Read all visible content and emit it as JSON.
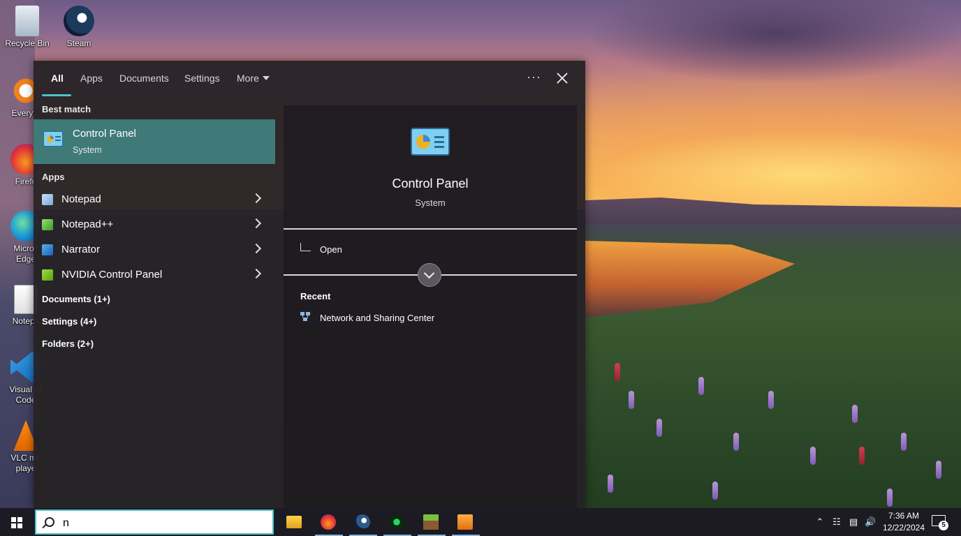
{
  "desktop": {
    "icons": [
      {
        "label": "Recycle Bin",
        "icon": "recycle-bin-icon"
      },
      {
        "label": "Steam",
        "icon": "steam-icon"
      },
      {
        "label": "Everyth",
        "icon": "everything-search-icon"
      },
      {
        "label": "Firefo",
        "icon": "firefox-icon"
      },
      {
        "label": "Micros\nEdge",
        "icon": "edge-icon"
      },
      {
        "label": "Notepa",
        "icon": "notepad-plus-plus-icon"
      },
      {
        "label": "Visual St\nCode",
        "icon": "vscode-icon"
      },
      {
        "label": "VLC me\nplaye",
        "icon": "vlc-icon"
      }
    ]
  },
  "search_panel": {
    "tabs": [
      {
        "label": "All",
        "active": true
      },
      {
        "label": "Apps"
      },
      {
        "label": "Documents"
      },
      {
        "label": "Settings"
      },
      {
        "label": "More"
      }
    ],
    "more_options_label": "···",
    "best_match": {
      "header": "Best match",
      "title": "Control Panel",
      "subtitle": "System"
    },
    "apps_header": "Apps",
    "apps": [
      {
        "label": "Notepad",
        "icon": "notepad-icon"
      },
      {
        "label": "Notepad++",
        "icon": "notepad-plus-plus-icon"
      },
      {
        "label": "Narrator",
        "icon": "narrator-icon"
      },
      {
        "label": "NVIDIA Control Panel",
        "icon": "nvidia-icon"
      }
    ],
    "groups": [
      {
        "label": "Documents (1+)"
      },
      {
        "label": "Settings (4+)"
      },
      {
        "label": "Folders (2+)"
      }
    ],
    "preview": {
      "title": "Control Panel",
      "subtitle": "System",
      "open_label": "Open",
      "recent_header": "Recent",
      "recent_items": [
        {
          "label": "Network and Sharing Center"
        }
      ]
    }
  },
  "taskbar": {
    "search_value": "n",
    "apps": [
      "file-explorer-icon",
      "firefox-icon",
      "steam-icon",
      "green-app-icon",
      "minecraft-icon",
      "orange-app-icon"
    ],
    "clock_time": "7:36 AM",
    "clock_date": "12/22/2024",
    "notification_count": "5"
  },
  "colors": {
    "accent": "#4fc3c9",
    "best_match_bg": "#3f7a78",
    "panel_bg": "#26222a",
    "taskbar_bg": "#1c1a22"
  }
}
